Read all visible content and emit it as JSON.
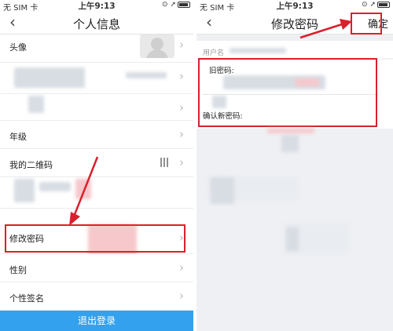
{
  "left_screen": {
    "status": {
      "carrier": "无 SIM 卡",
      "wifi_icon": "wifi-icon",
      "time": "上午9:13",
      "icons": "⊙ ➚"
    },
    "nav": {
      "back": "‹",
      "title": "个人信息"
    },
    "rows": {
      "avatar": "头像",
      "grade": "年级",
      "qrcode": "我的二维码",
      "change_password": "修改密码",
      "gender": "性别",
      "signature": "个性签名"
    },
    "logout": "退出登录"
  },
  "right_screen": {
    "status": {
      "carrier": "无 SIM 卡",
      "time": "上午9:13",
      "icons": "⊙ ➚"
    },
    "nav": {
      "back": "‹",
      "title": "修改密码",
      "confirm": "确定"
    },
    "username_label": "用户名",
    "old_password_label": "旧密码:",
    "confirm_new_password_label": "确认新密码:"
  },
  "colors": {
    "accent": "#34a1ee",
    "highlight": "#d9212c"
  }
}
